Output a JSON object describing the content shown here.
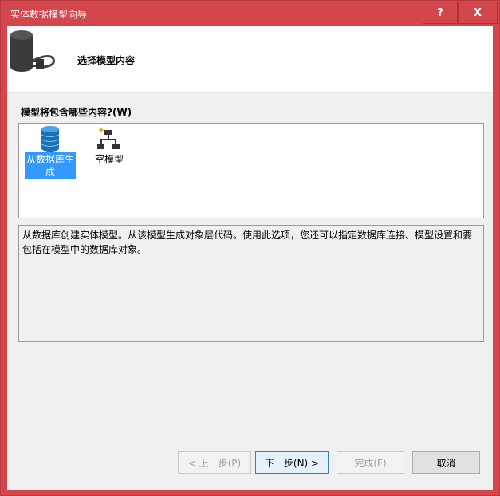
{
  "window": {
    "title": "实体数据模型向导",
    "help_label": "?",
    "close_label": "X"
  },
  "header": {
    "title": "选择模型内容",
    "icon": "database-plug-icon"
  },
  "content": {
    "question_label": "模型将包含哪些内容?(W)",
    "options": [
      {
        "label": "从数据库生成",
        "icon": "database-icon",
        "selected": true
      },
      {
        "label": "空模型",
        "icon": "empty-model-icon",
        "selected": false
      }
    ],
    "description": "从数据库创建实体模型。从该模型生成对象层代码。使用此选项，您还可以指定数据库连接、模型设置和要包括在模型中的数据库对象。"
  },
  "buttons": {
    "back": "< 上一步(P)",
    "next": "下一步(N) >",
    "finish": "完成(F)",
    "cancel": "取消"
  },
  "colors": {
    "title_bar": "#d2464c",
    "selection": "#3399ff"
  }
}
